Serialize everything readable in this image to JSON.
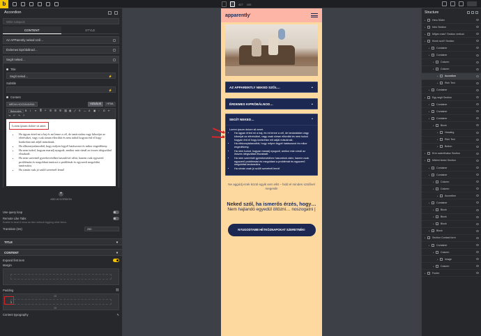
{
  "topbar": {
    "logo": "b",
    "zoom": "427",
    "size": "100"
  },
  "left": {
    "title": "Accordion",
    "search_placeholder": "Write rulepack",
    "tabs": [
      "CONTENT",
      "STYLE"
    ],
    "items": [
      "Az APParently neked szól…",
      "Érdemes kipróbálnod…",
      "Segít neked…"
    ],
    "fields": {
      "title_label": "Title",
      "title_value": "Segít neked…",
      "subtitle_label": "Subtitle",
      "content_label": "Content"
    },
    "editor": {
      "add_media": "MÉDIA HOZZÁADÁSA",
      "mode_visual": "VIZUÁLIS",
      "mode_html": "HTML",
      "format_select": "Bekezdés",
      "lorem": "Lorem ipsum dolore sit amet.",
      "bullets": [
        "Ha úgyan érted mi a baj és mi lenne a cél, de tanácstalan vagy kiboríjat az elérésüket, vagy csak siman elfordiát és nem tudod hogyan érd el hogy konkrétan mit adjál másoknak.",
        "Ha elbizonytalanodtál, hogy milyen legyél hatásosnot és mikor engedékeny.",
        "Ha nem tudod, hogyan maradj nyugodt, amikor már sírnál az összes idegszálad elszakadt.",
        "Ha nem szeretnél gyerekeveidhez hasonlóvá válni, hanem csak egyszerű problémást és megoldani tanácsot a problémát és egyszerű megoldási tanácsokra.",
        "Ha simán csak jó szülő szeretnél lenni!"
      ]
    },
    "add_accordion": "ADD ACCORDION",
    "options": {
      "use_query_loop": "Use query loop",
      "remote_title": "Remote Like Tabs",
      "remote_hint": "Enable to treat & show as item without toggling other items.",
      "transition_label": "Transition (ms)",
      "transition_value": "250"
    },
    "sections": {
      "title": "TITLE",
      "content": "CONTENT",
      "expand_first": "Expand first item",
      "margin": "Margin",
      "padding": "Padding",
      "padding_value": "0",
      "padding_top": "15",
      "padding_bottom": "15",
      "content_typography": "Content typography"
    }
  },
  "phone": {
    "brand_a": "apparently",
    "brand_b": "'",
    "accordion": [
      "AZ APPARENTLY NEKED SZÓL…",
      "ÉRDEMES KIPRÓBÁLNOD…",
      "SEGÍT NEKED…"
    ],
    "open_lorem": "Lorem ipsum dolore sit amet.",
    "open_bullets": [
      "Ha úgyan érted mi a baj, és mi lenne a cél, de tanácstalan vagy kiboríjat az elérésüket, vagy csak siman elfordiát és nem tudod hogyan érd el hogy konkrétan mit adjál másoknak.",
      "Ha elbizonytalanodtál, hogy milyen legyél hatásosnot és mikor engedékeny.",
      "Ha nem tudod, hogyan maradj nyugodt, amikor már sírnál az összes idegszálad elszakadt.",
      "Ha nem szeretnél gyerekeveidhez hasonlóvá válni, hanem csak egyszerű problémást és megoldani a problémát és egyszerű megoldási tanácsokra.",
      "Ha simán csak jó szülő szeretnél lenni!"
    ],
    "para": "Ne aggódj ezek közül egyik sem elkt – hidd el minden szülővel megesik!",
    "headline": "Neked szól, ha ismerős érzés, hogy…",
    "sub": "Nem hajlandó egyedül öltözni… noszogatni |",
    "cta": "NYUGODTABB HÉTKÖZNAPOKAT SZERETNÉK!"
  },
  "structure": {
    "title": "Structure",
    "rows": [
      {
        "label": "Hero Slider",
        "indent": 0
      },
      {
        "label": "Intro Section",
        "indent": 0
      },
      {
        "label": "Milyen más? Section vertical",
        "indent": 0
      },
      {
        "label": "Kinek szól? Section",
        "indent": 0
      },
      {
        "label": "Container",
        "indent": 1
      },
      {
        "label": "Container",
        "indent": 1
      },
      {
        "label": "Column",
        "indent": 2
      },
      {
        "label": "Column",
        "indent": 2
      },
      {
        "label": "Accordion",
        "indent": 3
      },
      {
        "label": "Rich Text",
        "indent": 3
      },
      {
        "label": "Container",
        "indent": 1
      },
      {
        "label": "Egy segít Section",
        "indent": 0
      },
      {
        "label": "Container",
        "indent": 1
      },
      {
        "label": "Container",
        "indent": 1
      },
      {
        "label": "Container",
        "indent": 1
      },
      {
        "label": "Block",
        "indent": 2
      },
      {
        "label": "Heading",
        "indent": 3
      },
      {
        "label": "Rich Text",
        "indent": 3
      },
      {
        "label": "Button",
        "indent": 3
      },
      {
        "label": "Erre számíthatsz Section",
        "indent": 0
      },
      {
        "label": "Miként fantor Section",
        "indent": 0
      },
      {
        "label": "Container",
        "indent": 1
      },
      {
        "label": "Container",
        "indent": 1
      },
      {
        "label": "Column",
        "indent": 2
      },
      {
        "label": "Column",
        "indent": 2
      },
      {
        "label": "Accordion",
        "indent": 3
      },
      {
        "label": "Container",
        "indent": 1
      },
      {
        "label": "Block",
        "indent": 2
      },
      {
        "label": "Block",
        "indent": 2
      },
      {
        "label": "Block",
        "indent": 2
      },
      {
        "label": "Block",
        "indent": 1
      },
      {
        "label": "Section Contact form",
        "indent": 0
      },
      {
        "label": "Container",
        "indent": 1
      },
      {
        "label": "Column",
        "indent": 2
      },
      {
        "label": "Image",
        "indent": 3
      },
      {
        "label": "Column",
        "indent": 2
      },
      {
        "label": "Footer",
        "indent": 0
      }
    ],
    "active_index": 8
  }
}
